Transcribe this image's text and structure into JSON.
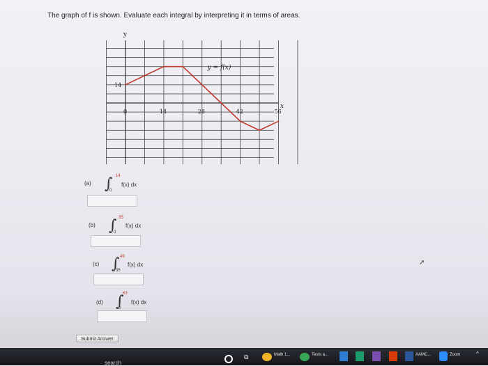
{
  "question": {
    "prompt": "The graph of f is shown. Evaluate each integral by interpreting it in terms of areas."
  },
  "graph": {
    "y_axis_label": "y",
    "x_axis_label": "x",
    "curve_label": "y = f(x)",
    "y_tick_label": "14",
    "x_tick_labels": [
      "0",
      "14",
      "28",
      "42",
      "56"
    ],
    "curve_color": "#c0392b"
  },
  "chart_data": {
    "type": "line",
    "x": [
      0,
      14,
      21,
      42,
      49,
      56
    ],
    "y": [
      14,
      28,
      28,
      -14,
      -21,
      -14
    ],
    "xlabel": "x",
    "ylabel": "y"
  },
  "parts": [
    {
      "label": "(a)",
      "upper": "14",
      "lower": "0",
      "integrand": "f(x) dx",
      "answer": ""
    },
    {
      "label": "(b)",
      "upper": "35",
      "lower": "0",
      "integrand": "f(x) dx",
      "answer": ""
    },
    {
      "label": "(c)",
      "upper": "49",
      "lower": "35",
      "integrand": "f(x) dx",
      "answer": ""
    },
    {
      "label": "(d)",
      "upper": "63",
      "lower": "0",
      "integrand": "f(x) dx",
      "answer": ""
    }
  ],
  "submit_label": "Submit Answer",
  "taskbar": {
    "search_text": "search",
    "items": [
      {
        "label": "Math 1...",
        "icon": "chrome-icon"
      },
      {
        "label": "Tests a...",
        "icon": "chrome-icon"
      },
      {
        "label": "AAMC...",
        "icon": "word-icon"
      },
      {
        "label": "Zoom",
        "icon": "zoom-icon"
      }
    ]
  }
}
